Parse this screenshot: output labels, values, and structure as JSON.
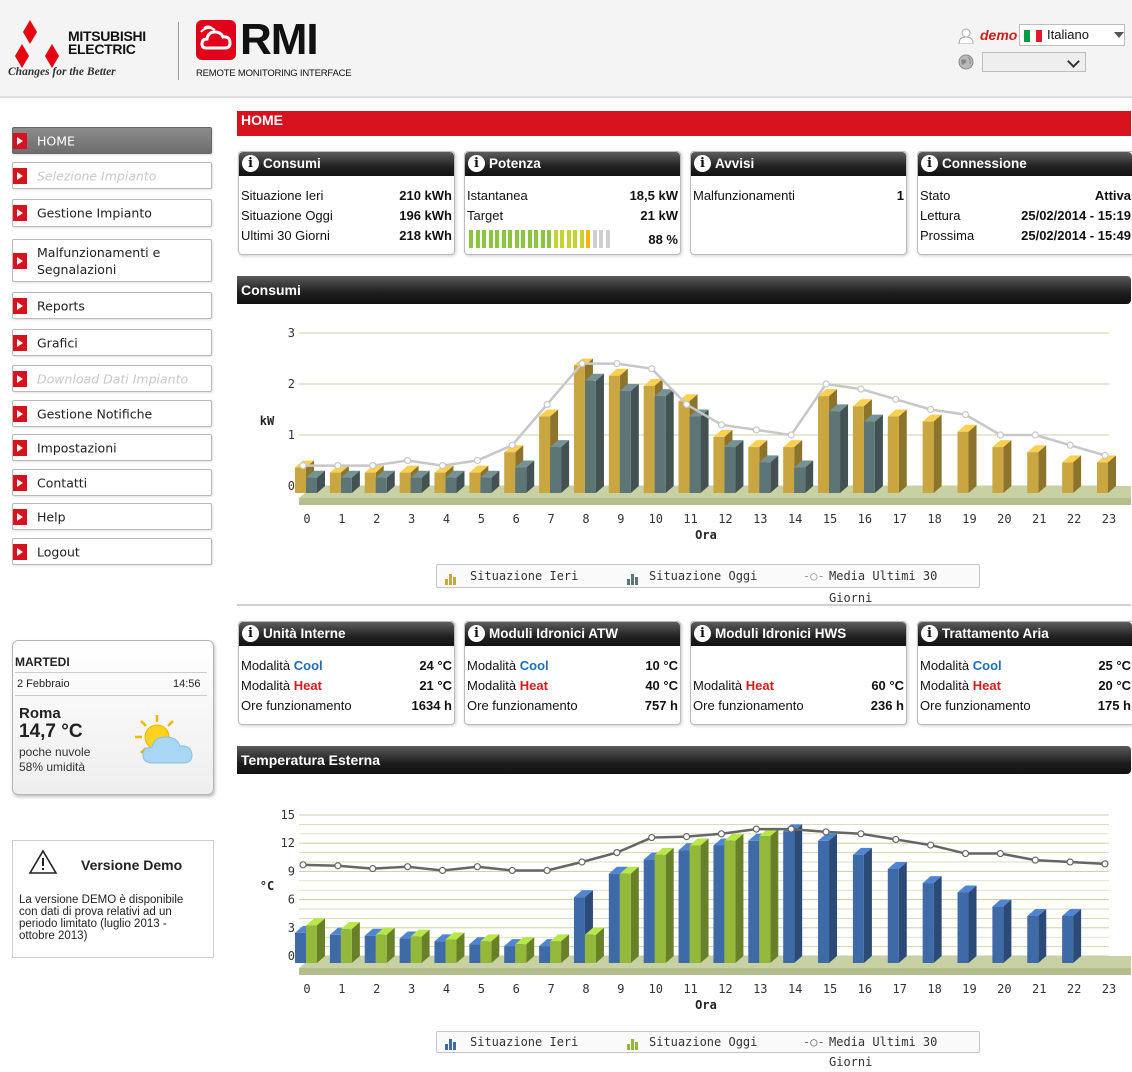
{
  "header": {
    "brand_name": "MITSUBISHI ELECTRIC",
    "brand_tagline": "Changes for the Better",
    "product_name": "RMI",
    "product_subtitle": "REMOTE MONITORING INTERFACE",
    "user": "demo",
    "language": "Italiano"
  },
  "sidebar": {
    "items": [
      {
        "label": "HOME",
        "state": "active"
      },
      {
        "label": "Selezione Impianto",
        "state": "disabled"
      },
      {
        "label": "Gestione Impianto",
        "state": "normal"
      },
      {
        "label": "Malfunzionamenti e Segnalazioni",
        "state": "normal"
      },
      {
        "label": "Reports",
        "state": "normal"
      },
      {
        "label": "Grafici",
        "state": "normal"
      },
      {
        "label": "Download Dati Impianto",
        "state": "disabled"
      },
      {
        "label": "Gestione Notifiche",
        "state": "normal"
      },
      {
        "label": "Impostazioni",
        "state": "normal"
      },
      {
        "label": "Contatti",
        "state": "normal"
      },
      {
        "label": "Help",
        "state": "normal"
      },
      {
        "label": "Logout",
        "state": "normal"
      }
    ]
  },
  "weather": {
    "day": "MARTEDI",
    "date": "2 Febbraio",
    "time": "14:56",
    "city": "Roma",
    "temperature": "14,7 °C",
    "condition": "poche nuvole",
    "humidity": "58% umidità"
  },
  "demo_notice": {
    "title": "Versione Demo",
    "text": "La versione DEMO è disponibile con dati di prova relativi ad un periodo limitato (luglio 2013 - ottobre 2013)"
  },
  "page_title": "HOME",
  "summary_boxes": {
    "consumi": {
      "title": "Consumi",
      "rows": [
        {
          "label": "Situazione Ieri",
          "value": "210 kWh"
        },
        {
          "label": "Situazione Oggi",
          "value": "196 kWh"
        },
        {
          "label": "Ultimi 30 Giorni",
          "value": "218 kWh"
        }
      ]
    },
    "potenza": {
      "title": "Potenza",
      "rows": [
        {
          "label": "Istantanea",
          "value": "18,5 kW"
        },
        {
          "label": "Target",
          "value": "21 kW"
        }
      ],
      "progress_percent": 88,
      "progress_label": "88 %"
    },
    "avvisi": {
      "title": "Avvisi",
      "rows": [
        {
          "label": "Malfunzionamenti",
          "value": "1"
        }
      ]
    },
    "connessione": {
      "title": "Connessione",
      "rows": [
        {
          "label": "Stato",
          "value": "Attiva"
        },
        {
          "label": "Lettura",
          "value": "25/02/2014 - 15:19"
        },
        {
          "label": "Prossima",
          "value": "25/02/2014 - 15:49"
        }
      ]
    }
  },
  "units_boxes": {
    "unita_interne": {
      "title": "Unità Interne",
      "cool_label": "Modalità",
      "cool_word": "Cool",
      "cool_value": "24 °C",
      "heat_label": "Modalità",
      "heat_word": "Heat",
      "heat_value": "21 °C",
      "hours_label": "Ore funzionamento",
      "hours_value": "1634 h"
    },
    "moduli_atw": {
      "title": "Moduli Idronici ATW",
      "cool_label": "Modalità",
      "cool_word": "Cool",
      "cool_value": "10 °C",
      "heat_label": "Modalità",
      "heat_word": "Heat",
      "heat_value": "40 °C",
      "hours_label": "Ore funzionamento",
      "hours_value": "757 h"
    },
    "moduli_hws": {
      "title": "Moduli Idronici HWS",
      "heat_label": "Modalità",
      "heat_word": "Heat",
      "heat_value": "60 °C",
      "hours_label": "Ore funzionamento",
      "hours_value": "236 h"
    },
    "trattamento_aria": {
      "title": "Trattamento Aria",
      "cool_label": "Modalità",
      "cool_word": "Cool",
      "cool_value": "25 °C",
      "heat_label": "Modalità",
      "heat_word": "Heat",
      "heat_value": "20 °C",
      "hours_label": "Ore funzionamento",
      "hours_value": "175 h"
    }
  },
  "sections": {
    "consumi_title": "Consumi",
    "temperatura_title": "Temperatura Esterna"
  },
  "chart_data": [
    {
      "type": "bar",
      "title": "Consumi",
      "xlabel": "Ora",
      "ylabel": "kW",
      "ylim": [
        0,
        3
      ],
      "yticks": [
        0,
        1,
        2,
        3
      ],
      "grid": true,
      "legend_position": "bottom",
      "categories": [
        "0",
        "1",
        "2",
        "3",
        "4",
        "5",
        "6",
        "7",
        "8",
        "9",
        "10",
        "11",
        "12",
        "13",
        "14",
        "15",
        "16",
        "17",
        "18",
        "19",
        "20",
        "21",
        "22",
        "23"
      ],
      "series": [
        {
          "name": "Situazione Ieri",
          "kind": "bar",
          "color": "#c9a640",
          "values": [
            0.5,
            0.4,
            0.4,
            0.4,
            0.4,
            0.4,
            0.8,
            1.5,
            2.5,
            2.3,
            2.1,
            1.8,
            1.1,
            0.9,
            0.9,
            1.9,
            1.7,
            1.5,
            1.4,
            1.2,
            0.9,
            0.8,
            0.6,
            0.6
          ]
        },
        {
          "name": "Situazione Oggi",
          "kind": "bar",
          "color": "#5e7576",
          "values": [
            0.3,
            0.3,
            0.3,
            0.3,
            0.3,
            0.3,
            0.5,
            0.9,
            2.2,
            2.0,
            1.9,
            1.5,
            0.9,
            0.6,
            0.5,
            1.6,
            1.4,
            null,
            null,
            null,
            null,
            null,
            null,
            null
          ]
        },
        {
          "name": "Media Ultimi 30 Giorni",
          "kind": "line",
          "color": "#c7c7c7",
          "values": [
            0.4,
            0.4,
            0.4,
            0.5,
            0.4,
            0.5,
            0.8,
            1.6,
            2.4,
            2.4,
            2.3,
            1.6,
            1.2,
            1.1,
            1.0,
            2.0,
            1.9,
            1.7,
            1.5,
            1.4,
            1.0,
            1.0,
            0.8,
            0.6
          ]
        }
      ]
    },
    {
      "type": "bar",
      "title": "Temperatura Esterna",
      "xlabel": "Ora",
      "ylabel": "°C",
      "ylim": [
        0,
        15
      ],
      "yticks": [
        0,
        3,
        6,
        9,
        12,
        15
      ],
      "grid": true,
      "legend_position": "bottom",
      "categories": [
        "0",
        "1",
        "2",
        "3",
        "4",
        "5",
        "6",
        "7",
        "8",
        "9",
        "10",
        "11",
        "12",
        "13",
        "14",
        "15",
        "16",
        "17",
        "18",
        "19",
        "20",
        "21",
        "22",
        "23"
      ],
      "series": [
        {
          "name": "Situazione Ieri",
          "kind": "bar",
          "color": "#3f6aa8",
          "values": [
            3.2,
            3.0,
            2.9,
            2.6,
            2.3,
            2.0,
            1.8,
            1.8,
            7.0,
            9.5,
            11.0,
            12.0,
            12.5,
            13.0,
            14.0,
            13.0,
            11.5,
            10.0,
            8.5,
            7.5,
            6.0,
            5.0,
            5.0,
            null
          ]
        },
        {
          "name": "Situazione Oggi",
          "kind": "bar",
          "color": "#94b83a",
          "values": [
            4.0,
            3.6,
            3.0,
            2.8,
            2.5,
            2.3,
            2.0,
            2.3,
            3.0,
            9.5,
            11.5,
            12.5,
            13.0,
            13.5,
            null,
            null,
            null,
            null,
            null,
            null,
            null,
            null,
            null,
            null
          ]
        },
        {
          "name": "Media Ultimi 30 Giorni",
          "kind": "line",
          "color": "#666666",
          "values": [
            9.7,
            9.6,
            9.3,
            9.5,
            9.1,
            9.5,
            9.1,
            9.1,
            10.0,
            11.0,
            12.6,
            12.7,
            13.0,
            13.5,
            13.5,
            13.2,
            13.0,
            12.4,
            11.8,
            10.9,
            10.9,
            10.2,
            10.0,
            9.8
          ]
        }
      ]
    }
  ],
  "colors": {
    "brand_red": "#d7121e",
    "cool": "#1f6fb5",
    "heat": "#d21c1c"
  }
}
